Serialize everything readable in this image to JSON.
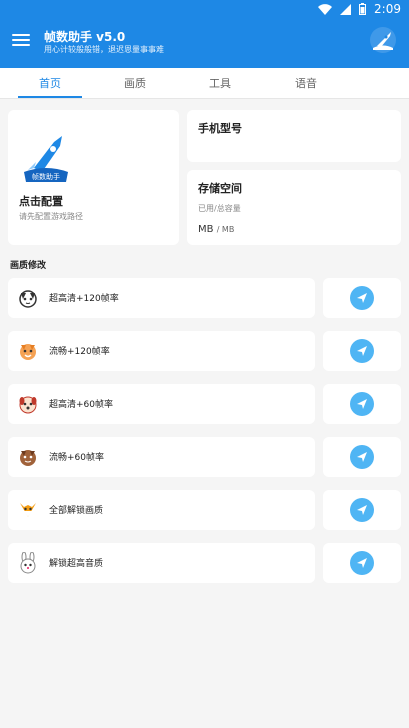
{
  "status_bar": {
    "time": "2:09"
  },
  "app_bar": {
    "title": "帧数助手 v5.0",
    "subtitle": "用心计较般般错，退迟恩量事事难",
    "menu_icon": "menu-icon",
    "logo_icon": "rocket-logo-icon"
  },
  "tabs": [
    {
      "label": "首页",
      "active": true
    },
    {
      "label": "画质",
      "active": false
    },
    {
      "label": "工具",
      "active": false
    },
    {
      "label": "语音",
      "active": false
    }
  ],
  "config_card": {
    "title": "点击配置",
    "subtitle": "请先配置游戏路径",
    "logo_text": "帧数助手"
  },
  "model_card": {
    "title": "手机型号"
  },
  "storage_card": {
    "title": "存储空间",
    "subtitle": "已用/总容量",
    "value": "MB",
    "unit": "/ MB"
  },
  "section_title": "画质修改",
  "items": [
    {
      "label": "超高清+120帧率",
      "icon": "cat-icon"
    },
    {
      "label": "流畅+120帧率",
      "icon": "tiger-icon"
    },
    {
      "label": "超高清+60帧率",
      "icon": "dog-icon"
    },
    {
      "label": "流畅+60帧率",
      "icon": "brown-tiger-icon"
    },
    {
      "label": "全部解锁画质",
      "icon": "fox-icon"
    },
    {
      "label": "解锁超高音质",
      "icon": "rabbit-icon"
    }
  ],
  "colors": {
    "primary": "#1e88e5",
    "send_button": "#4fb5f4",
    "background": "#f5f5f5"
  }
}
